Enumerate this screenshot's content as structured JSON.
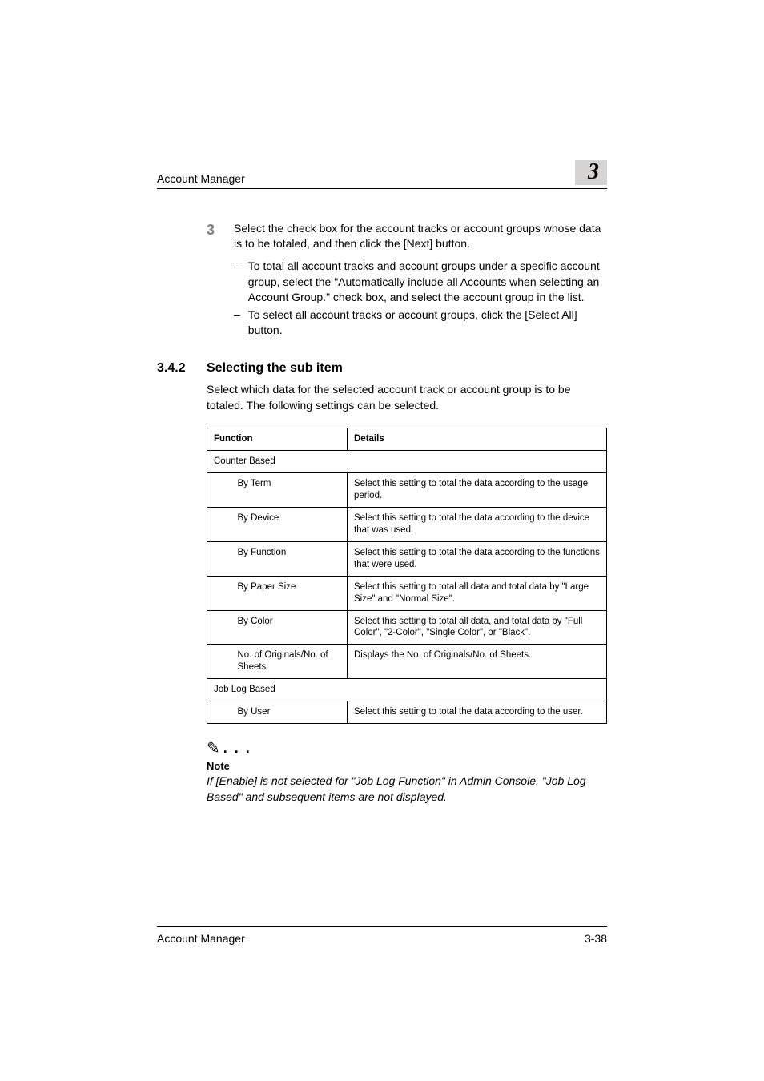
{
  "header": {
    "title": "Account Manager",
    "chapter": "3"
  },
  "step": {
    "num": "3",
    "text": "Select the check box for the account tracks or account groups whose data is to be totaled, and then click the [Next] button.",
    "subs": [
      "To total all account tracks and account groups under a specific account group, select the \"Automatically include all Accounts when selecting an Account Group.\" check box, and select the account group in the list.",
      "To select all account tracks or account groups, click the [Select All] button."
    ]
  },
  "section": {
    "num": "3.4.2",
    "title": "Selecting the sub item",
    "para": "Select which data for the selected account track or account group is to be totaled. The following settings can be selected."
  },
  "table": {
    "h1": "Function",
    "h2": "Details",
    "group1": "Counter Based",
    "rows1": [
      {
        "name": "By Term",
        "details": "Select this setting to total the data according to the usage period."
      },
      {
        "name": "By Device",
        "details": "Select this setting to total the data according to the device that was used."
      },
      {
        "name": "By Function",
        "details": "Select this setting to total the data according to the functions that were used."
      },
      {
        "name": "By Paper Size",
        "details": "Select this setting to total all data and total data by \"Large Size\" and \"Normal Size\"."
      },
      {
        "name": "By Color",
        "details": "Select this setting to total all data, and total data by \"Full Color\", \"2-Color\", \"Single Color\", or \"Black\"."
      },
      {
        "name": "No. of Originals/No. of Sheets",
        "details": "Displays the No. of Originals/No. of Sheets."
      }
    ],
    "group2": "Job Log Based",
    "rows2": [
      {
        "name": "By User",
        "details": "Select this setting to total the data according to the user."
      }
    ]
  },
  "note": {
    "label": "Note",
    "body": "If [Enable] is not selected for \"Job Log Function\" in Admin Console, \"Job Log Based\" and subsequent items are not displayed."
  },
  "footer": {
    "left": "Account Manager",
    "right": "3-38"
  }
}
